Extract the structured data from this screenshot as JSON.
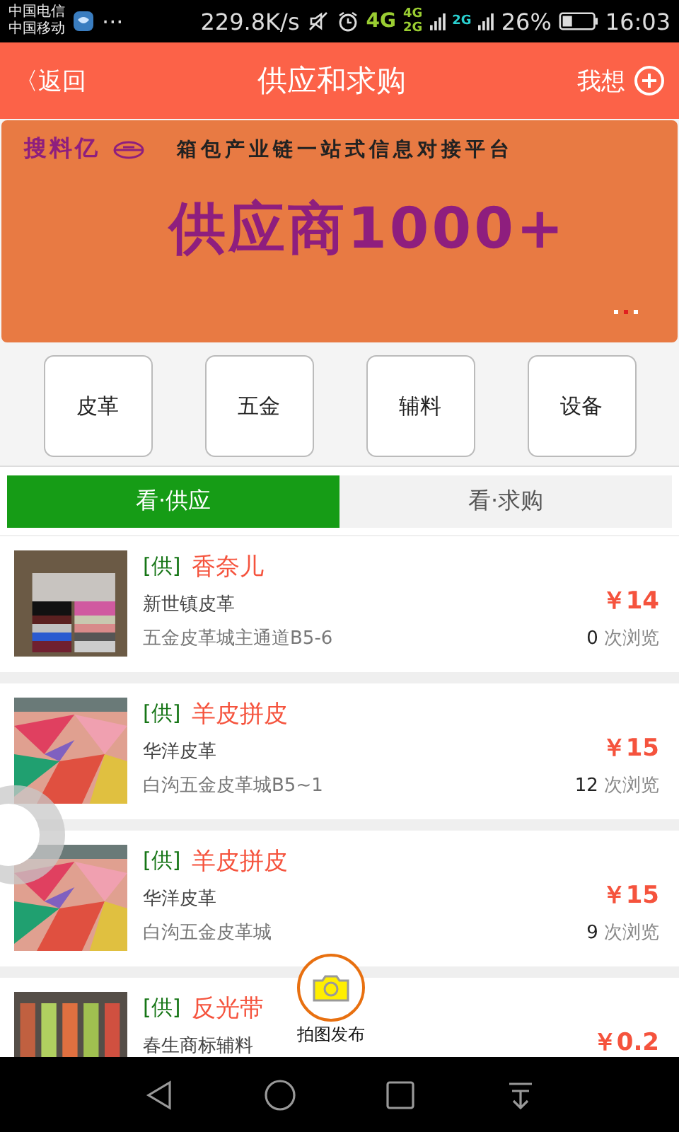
{
  "status_bar": {
    "carriers": [
      "中国电信",
      "中国移动"
    ],
    "more": "···",
    "speed": "229.8K/s",
    "network": [
      "4G",
      "4G",
      "2G",
      "2G"
    ],
    "battery": "26%",
    "time": "16:03"
  },
  "header": {
    "back": "〈返回",
    "title": "供应和求购",
    "action": "我想"
  },
  "banner": {
    "brand": "搜料亿",
    "slogan": "箱包产业链一站式信息对接平台",
    "headline": "供应商1000+",
    "dots": [
      {
        "selected": false
      },
      {
        "selected": true
      },
      {
        "selected": false
      }
    ]
  },
  "categories": [
    "皮革",
    "五金",
    "辅料",
    "设备"
  ],
  "tabs": [
    {
      "label": "看·供应",
      "selected": true
    },
    {
      "label": "看·求购",
      "selected": false
    }
  ],
  "items": [
    {
      "tag": "[供]",
      "title": "香奈儿",
      "shop": "新世镇皮革",
      "address": "五金皮革城主通道B5-6",
      "price": "￥14",
      "views": "0",
      "views_label": "次浏览"
    },
    {
      "tag": "[供]",
      "title": "羊皮拼皮",
      "shop": "华洋皮革",
      "address": "白沟五金皮革城B5~1",
      "price": "￥15",
      "views": "12",
      "views_label": "次浏览"
    },
    {
      "tag": "[供]",
      "title": "羊皮拼皮",
      "shop": "华洋皮革",
      "address": "白沟五金皮革城",
      "price": "￥15",
      "views": "9",
      "views_label": "次浏览"
    },
    {
      "tag": "[供]",
      "title": "反光带",
      "shop": "春生商标辅料",
      "price": "￥0.2"
    }
  ],
  "publish_button": {
    "label": "拍图发布"
  }
}
